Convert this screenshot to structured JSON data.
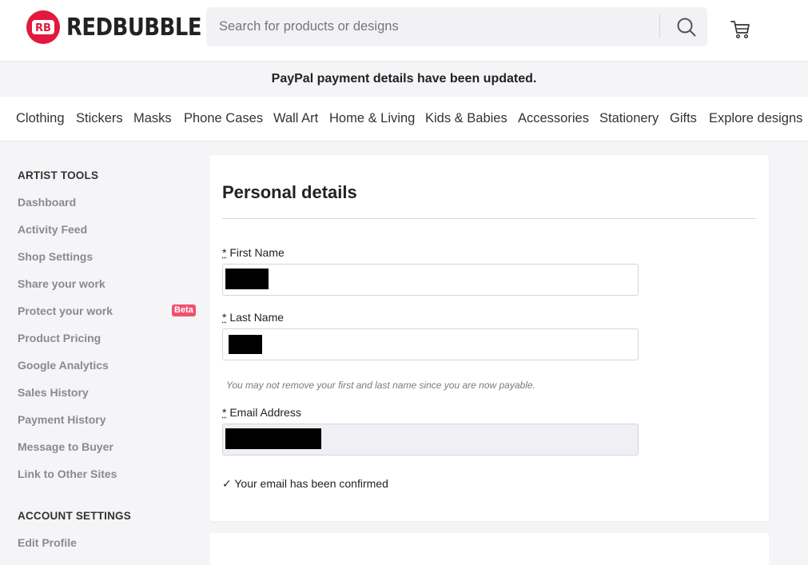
{
  "header": {
    "logo_text": "REDBUBBLE",
    "logo_badge": "RB",
    "search_placeholder": "Search for products or designs",
    "search_value": "",
    "icons": [
      "search-icon",
      "cart-icon"
    ]
  },
  "banner": {
    "message": "PayPal payment details have been updated."
  },
  "nav": {
    "items": [
      "Clothing",
      "Stickers",
      "Masks",
      "Phone Cases",
      "Wall Art",
      "Home & Living",
      "Kids & Babies",
      "Accessories",
      "Stationery",
      "Gifts",
      "Explore designs"
    ]
  },
  "sidebar": {
    "artist_tools_title": "ARTIST TOOLS",
    "artist_tools": [
      "Dashboard",
      "Activity Feed",
      "Shop Settings",
      "Share your work",
      "Protect your work",
      "Product Pricing",
      "Google Analytics",
      "Sales History",
      "Payment History",
      "Message to Buyer",
      "Link to Other Sites"
    ],
    "beta_label": "Beta",
    "account_settings_title": "ACCOUNT SETTINGS",
    "account_settings": [
      "Edit Profile"
    ]
  },
  "personal_details": {
    "title": "Personal details",
    "required_marker": "*",
    "first_name_label": "First Name",
    "last_name_label": "Last Name",
    "name_hint": "You may not remove your first and last name since you are now payable.",
    "email_label": "Email Address",
    "email_confirmed": "✓ Your email has been confirmed"
  },
  "colors": {
    "brand": "#e4173e",
    "beta_badge": "#f0506e",
    "sidebar_link": "#8a8a8f",
    "page_background": "#f5f5f7"
  }
}
